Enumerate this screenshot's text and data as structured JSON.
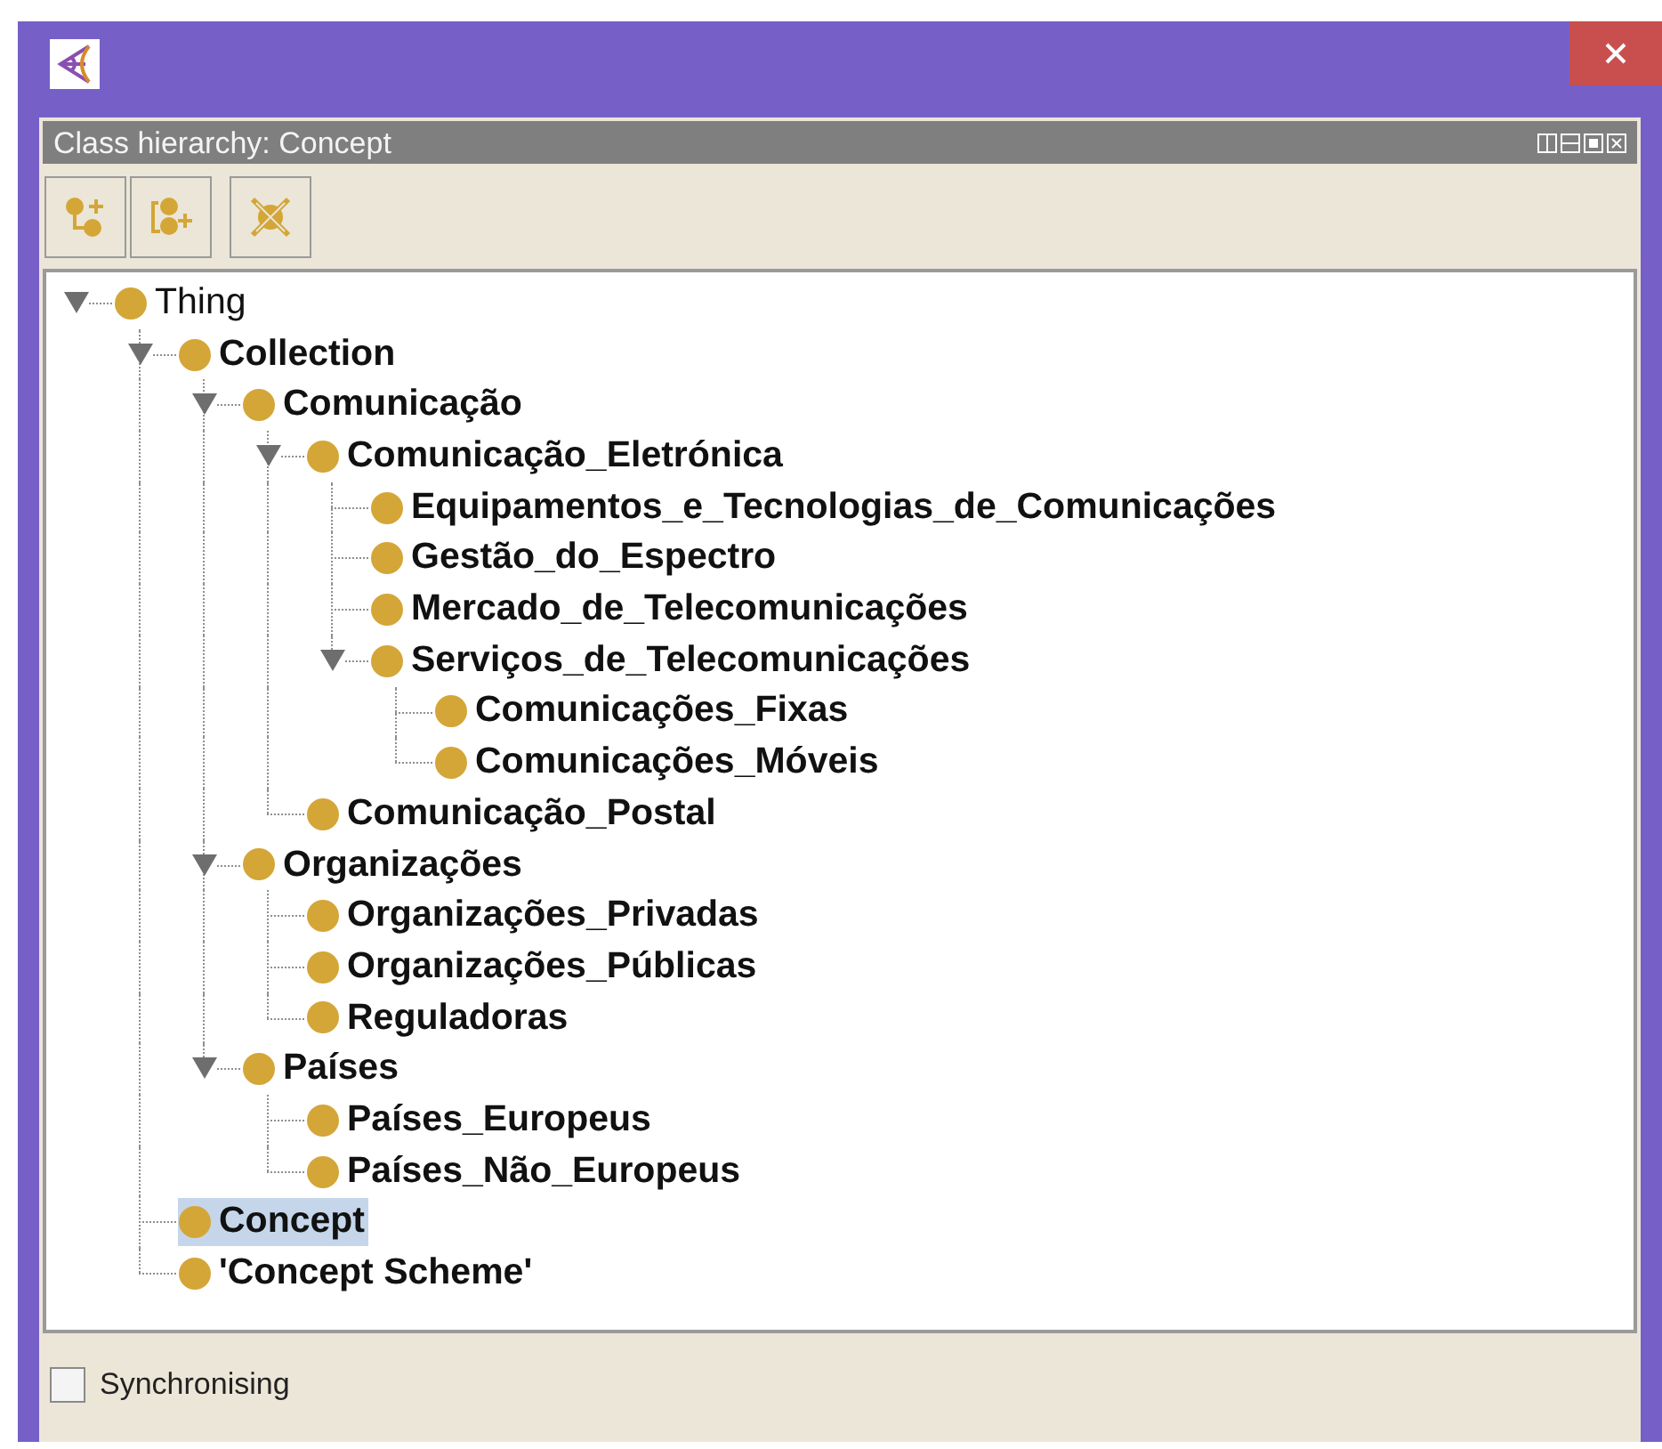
{
  "panel": {
    "title": "Class hierarchy: Concept"
  },
  "tree": [
    {
      "label": "Thing",
      "bold": false,
      "selected": false,
      "expanded": true,
      "children": [
        {
          "label": "Collection",
          "bold": true,
          "selected": false,
          "expanded": true,
          "children": [
            {
              "label": "Comunicação",
              "bold": true,
              "selected": false,
              "expanded": true,
              "children": [
                {
                  "label": "Comunicação_Eletrónica",
                  "bold": true,
                  "selected": false,
                  "expanded": true,
                  "children": [
                    {
                      "label": "Equipamentos_e_Tecnologias_de_Comunicações",
                      "bold": true,
                      "selected": false
                    },
                    {
                      "label": "Gestão_do_Espectro",
                      "bold": true,
                      "selected": false
                    },
                    {
                      "label": "Mercado_de_Telecomunicações",
                      "bold": true,
                      "selected": false
                    },
                    {
                      "label": "Serviços_de_Telecomunicações",
                      "bold": true,
                      "selected": false,
                      "expanded": true,
                      "children": [
                        {
                          "label": "Comunicações_Fixas",
                          "bold": true,
                          "selected": false
                        },
                        {
                          "label": "Comunicações_Móveis",
                          "bold": true,
                          "selected": false
                        }
                      ]
                    }
                  ]
                },
                {
                  "label": "Comunicação_Postal",
                  "bold": true,
                  "selected": false
                }
              ]
            },
            {
              "label": "Organizações",
              "bold": true,
              "selected": false,
              "expanded": true,
              "children": [
                {
                  "label": "Organizações_Privadas",
                  "bold": true,
                  "selected": false
                },
                {
                  "label": "Organizações_Públicas",
                  "bold": true,
                  "selected": false
                },
                {
                  "label": "Reguladoras",
                  "bold": true,
                  "selected": false
                }
              ]
            },
            {
              "label": "Países",
              "bold": true,
              "selected": false,
              "expanded": true,
              "children": [
                {
                  "label": "Países_Europeus",
                  "bold": true,
                  "selected": false
                },
                {
                  "label": "Países_Não_Europeus",
                  "bold": true,
                  "selected": false
                }
              ]
            }
          ]
        },
        {
          "label": "Concept",
          "bold": true,
          "selected": true
        },
        {
          "label": "'Concept Scheme'",
          "bold": true,
          "selected": false
        }
      ]
    }
  ],
  "synchronising": {
    "label": "Synchronising",
    "checked": false
  }
}
